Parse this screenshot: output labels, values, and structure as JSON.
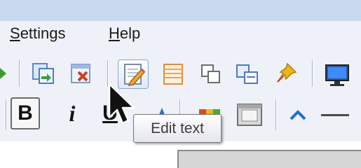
{
  "menu": {
    "settings_label": "Settings",
    "settings_mnemonic": "S",
    "settings_rest": "ettings",
    "help_label": "Help",
    "help_mnemonic": "H",
    "help_rest": "elp"
  },
  "toolbar": {
    "bold_label": "B",
    "italic_label": "i",
    "underline_label": "U",
    "icons": [
      "next-icon",
      "copy-page-icon",
      "delete-page-icon",
      "edit-text-icon",
      "list-icon",
      "copy-icon",
      "paste-icon",
      "pin-icon",
      "monitor-icon",
      "color-palette-icon",
      "frame-icon",
      "caret-up-icon",
      "minus-icon"
    ]
  },
  "tooltip": {
    "text": "Edit text"
  },
  "colors": {
    "titlebar": "#c9d9ee",
    "toolbar": "#eef1f8",
    "accent_blue": "#1e6fd0",
    "pin_yellow": "#e8b51a",
    "delete_red": "#d23b1a"
  }
}
